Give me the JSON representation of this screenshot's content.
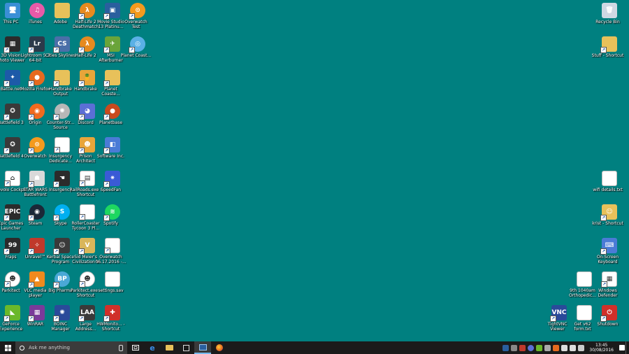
{
  "desktop": {
    "background": "#008080",
    "icons": [
      {
        "label": "This PC",
        "color": "#3a8fd6",
        "glyph": "🖥",
        "sc": false
      },
      {
        "label": "iTunes",
        "color": "#e85aa8",
        "glyph": "♫",
        "sc": false,
        "round": true
      },
      {
        "label": "Adobe",
        "color": "#e8c15a",
        "glyph": "",
        "sc": false
      },
      {
        "label": "Half-Life 2 Deathmatch",
        "color": "#e68a1f",
        "glyph": "λ",
        "sc": true,
        "round": true
      },
      {
        "label": "Movie Studio 13 Platinu...",
        "color": "#2a5f9e",
        "glyph": "▣",
        "sc": true
      },
      {
        "label": "Overwatch Test",
        "color": "#f39a1e",
        "glyph": "⊙",
        "sc": true,
        "round": true
      },
      {
        "label": "3D Vision Photo Viewer",
        "color": "#2b2b2b",
        "glyph": "▦",
        "sc": true
      },
      {
        "label": "Lightroom 5.3 64-bit",
        "color": "#2c3a4a",
        "glyph": "Lr",
        "sc": true
      },
      {
        "label": "Cities Skylines",
        "color": "#4b6fa8",
        "glyph": "CS",
        "sc": true
      },
      {
        "label": "Half-Life 2",
        "color": "#e68a1f",
        "glyph": "λ",
        "sc": true,
        "round": true
      },
      {
        "label": "MSI Afterburner",
        "color": "#6aa43a",
        "glyph": "✈",
        "sc": true
      },
      {
        "label": "Planet Coast...",
        "color": "#5ab0e6",
        "glyph": "◎",
        "sc": true,
        "round": true
      },
      {
        "label": "Battle.net",
        "color": "#1d5aa8",
        "glyph": "✦",
        "sc": true
      },
      {
        "label": "Mozilla Firefox",
        "color": "#e66a1f",
        "glyph": "●",
        "sc": true,
        "round": true
      },
      {
        "label": "Handbrake Output",
        "color": "#e8c15a",
        "glyph": "",
        "sc": true
      },
      {
        "label": "Handbrake",
        "color": "#e8a53a",
        "glyph": "🍍",
        "sc": true
      },
      {
        "label": "Planet Coaste...",
        "color": "#e8c15a",
        "glyph": "",
        "sc": true
      },
      {
        "label": "Battlefield 3",
        "color": "#3a3a3a",
        "glyph": "✪",
        "sc": true
      },
      {
        "label": "Origin",
        "color": "#f06a1e",
        "glyph": "◉",
        "sc": true,
        "round": true
      },
      {
        "label": "Counter-Str... Source",
        "color": "#b7b7b7",
        "glyph": "✺",
        "sc": true,
        "round": true
      },
      {
        "label": "Discord",
        "color": "#5b6fd6",
        "glyph": "◕",
        "sc": true
      },
      {
        "label": "Planetbase",
        "color": "#c84a1e",
        "glyph": "●",
        "sc": true,
        "round": true
      },
      {
        "label": "Battlefield 4",
        "color": "#3a3a3a",
        "glyph": "✪",
        "sc": true
      },
      {
        "label": "Overwatch",
        "color": "#f39a1e",
        "glyph": "⊙",
        "sc": true,
        "round": true
      },
      {
        "label": "Insurgency Dedicate...",
        "color": "#ffffff",
        "glyph": "",
        "sc": true
      },
      {
        "label": "Prison Architect",
        "color": "#e8a53a",
        "glyph": "☻",
        "sc": true
      },
      {
        "label": "Software Inc.",
        "color": "#4a7bd6",
        "glyph": "◧",
        "sc": true
      },
      {
        "label": "devolo Cockpit",
        "color": "#ffffff",
        "glyph": "⌂",
        "sc": true
      },
      {
        "label": "STAR WARS Battlefront",
        "color": "#d9d9d9",
        "glyph": "☗",
        "sc": true
      },
      {
        "label": "Insurgency",
        "color": "#2b2b2b",
        "glyph": "☚",
        "sc": true
      },
      {
        "label": "RailRoads.exe - Shortcut",
        "color": "#ffffff",
        "glyph": "▤",
        "sc": true
      },
      {
        "label": "SpeedFan",
        "color": "#3a5ad6",
        "glyph": "✷",
        "sc": true
      },
      {
        "label": "Epic Games Launcher",
        "color": "#2b2b2b",
        "glyph": "EPIC",
        "sc": true
      },
      {
        "label": "Steam",
        "color": "#1b2838",
        "glyph": "◉",
        "sc": true,
        "round": true
      },
      {
        "label": "Skype",
        "color": "#00aff0",
        "glyph": "S",
        "sc": true,
        "round": true
      },
      {
        "label": "RollerCoaster Tycoon 3 Pl...",
        "color": "#ffffff",
        "glyph": "",
        "sc": true
      },
      {
        "label": "Spotify",
        "color": "#1ed760",
        "glyph": "≋",
        "sc": true,
        "round": true
      },
      {
        "label": "Fraps",
        "color": "#2b2b2b",
        "glyph": "99",
        "sc": true
      },
      {
        "label": "Unravel™",
        "color": "#c0392b",
        "glyph": "✧",
        "sc": true
      },
      {
        "label": "Kerbal Space Program",
        "color": "#3a3a3a",
        "glyph": "☺",
        "sc": true
      },
      {
        "label": "Sid Meier's Civilization V",
        "color": "#d9b65a",
        "glyph": "V",
        "sc": true
      },
      {
        "label": "Overwatch 06.17.2016 -...",
        "color": "#ffffff",
        "glyph": "",
        "sc": true
      },
      {
        "label": "Parkitect",
        "color": "#ffffff",
        "glyph": "☻",
        "sc": true,
        "round": true
      },
      {
        "label": "VLC media player",
        "color": "#f08a1e",
        "glyph": "▲",
        "sc": true
      },
      {
        "label": "Big Pharma",
        "color": "#4aa8d6",
        "glyph": "BP",
        "sc": true,
        "round": true
      },
      {
        "label": "Parkitect.exe - Shortcut",
        "color": "#ffffff",
        "glyph": "☻",
        "sc": true,
        "round": true
      },
      {
        "label": "settings.sav",
        "color": "#ffffff",
        "glyph": "",
        "sc": false
      },
      {
        "label": "GeForce Experience",
        "color": "#6ab82a",
        "glyph": "◣",
        "sc": true
      },
      {
        "label": "WinRAR",
        "color": "#7a3a9a",
        "glyph": "▦",
        "sc": true
      },
      {
        "label": "BOINC Manager",
        "color": "#2a4a9a",
        "glyph": "✺",
        "sc": true
      },
      {
        "label": "Large Address...",
        "color": "#3a3a3a",
        "glyph": "LAA",
        "sc": true
      },
      {
        "label": "HWMonito... - Shortcut",
        "color": "#d0302a",
        "glyph": "✚",
        "sc": true
      },
      {
        "label": "Recycle Bin",
        "color": "#cfd8e3",
        "glyph": "🗑",
        "sc": false
      },
      {
        "label": "Stuff - Shortcut",
        "color": "#e8c15a",
        "glyph": "",
        "sc": true
      },
      {
        "label": "wifi details.txt",
        "color": "#ffffff",
        "glyph": "",
        "sc": false
      },
      {
        "label": "krist - Shortcut",
        "color": "#e8c15a",
        "glyph": "☺",
        "sc": true
      },
      {
        "label": "On-Screen Keyboard",
        "color": "#4a7bd6",
        "glyph": "⌨",
        "sc": true
      },
      {
        "label": "9th 1040am Orthopedic...",
        "color": "#ffffff",
        "glyph": "",
        "sc": false
      },
      {
        "label": "Windows Defender",
        "color": "#ffffff",
        "glyph": "▦",
        "sc": true
      },
      {
        "label": "TightVNC Viewer",
        "color": "#2a4a9a",
        "glyph": "VNC",
        "sc": true
      },
      {
        "label": "Get v62 form.txt",
        "color": "#ffffff",
        "glyph": "",
        "sc": false
      },
      {
        "label": "Shutdown",
        "color": "#d0302a",
        "glyph": "⏻",
        "sc": true
      }
    ]
  },
  "taskbar": {
    "search_placeholder": "Ask me anything",
    "time": "13:45",
    "date": "30/08/2016"
  }
}
